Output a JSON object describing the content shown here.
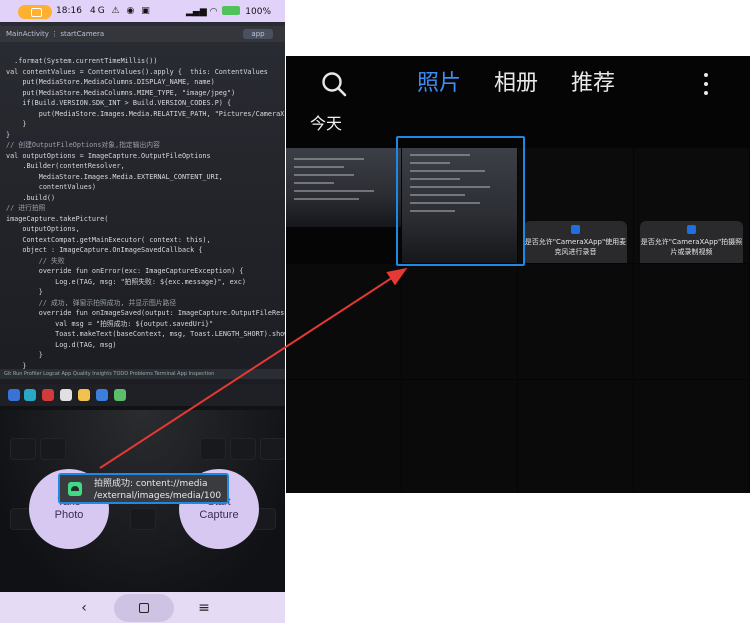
{
  "phone": {
    "status_bar": {
      "time": "18:16",
      "right_text": "100%",
      "dots": "4G ⚠ ◉ ▣"
    },
    "ide": {
      "tab_text": "MainActivity ⋮ startCamera",
      "run_config": "app",
      "code_lines": [
        "  .format(System.currentTimeMillis())",
        "val contentValues = ContentValues().apply {  this: ContentValues",
        "    put(MediaStore.MediaColumns.DISPLAY_NAME, name)",
        "    put(MediaStore.MediaColumns.MIME_TYPE, \"image/jpeg\")",
        "    if(Build.VERSION.SDK_INT > Build.VERSION_CODES.P) {",
        "        put(MediaStore.Images.Media.RELATIVE_PATH, \"Pictures/CameraX-I",
        "    }",
        "}",
        "// 创建OutputFileOptions对象,指定输出内容",
        "val outputOptions = ImageCapture.OutputFileOptions",
        "    .Builder(contentResolver,",
        "        MediaStore.Images.Media.EXTERNAL_CONTENT_URI,",
        "        contentValues)",
        "    .build()",
        "// 进行拍照",
        "imageCapture.takePicture(",
        "    outputOptions,",
        "    ContextCompat.getMainExecutor( context: this),",
        "    object : ImageCapture.OnImageSavedCallback {",
        "        // 失败",
        "        override fun onError(exc: ImageCaptureException) {",
        "            Log.e(TAG, msg: \"拍照失败: ${exc.message}\", exc)",
        "        }",
        "        // 成功, 弹窗示拍照成功, 并显示图片路径",
        "        override fun onImageSaved(output: ImageCapture.OutputFileResults){",
        "            val msg = \"拍照成功: ${output.savedUri}\"",
        "            Toast.makeText(baseContext, msg, Toast.LENGTH_SHORT).show()",
        "            Log.d(TAG, msg)",
        "        }",
        "    }",
        "  )"
      ],
      "bottom_bar": "Git  Run  Profiler  Logcat  App Quality Insights  TODO  Problems  Terminal  App Inspection"
    },
    "buttons": {
      "take_photo": "Take\nPhoto",
      "start_capture": "Start\nCapture"
    },
    "toast": {
      "line1": "拍照成功: content://media",
      "line2": "/external/images/media/100..."
    },
    "nav": {
      "back": "‹",
      "menu": "≡"
    }
  },
  "gallery": {
    "tabs": [
      {
        "label": "照片",
        "active": true
      },
      {
        "label": "相册",
        "active": false
      },
      {
        "label": "推荐",
        "active": false
      }
    ],
    "section_title": "今天",
    "permission_cards": [
      "是否允许\"CameraXApp\"使用麦克风进行录音",
      "是否允许\"CameraXApp\"拍摄照片或录制视频"
    ]
  },
  "colors": {
    "accent": "#3c8df4",
    "highlight_frame": "#1e88e5",
    "arrow": "#e53935",
    "button_fill": "#d6c8f0"
  }
}
